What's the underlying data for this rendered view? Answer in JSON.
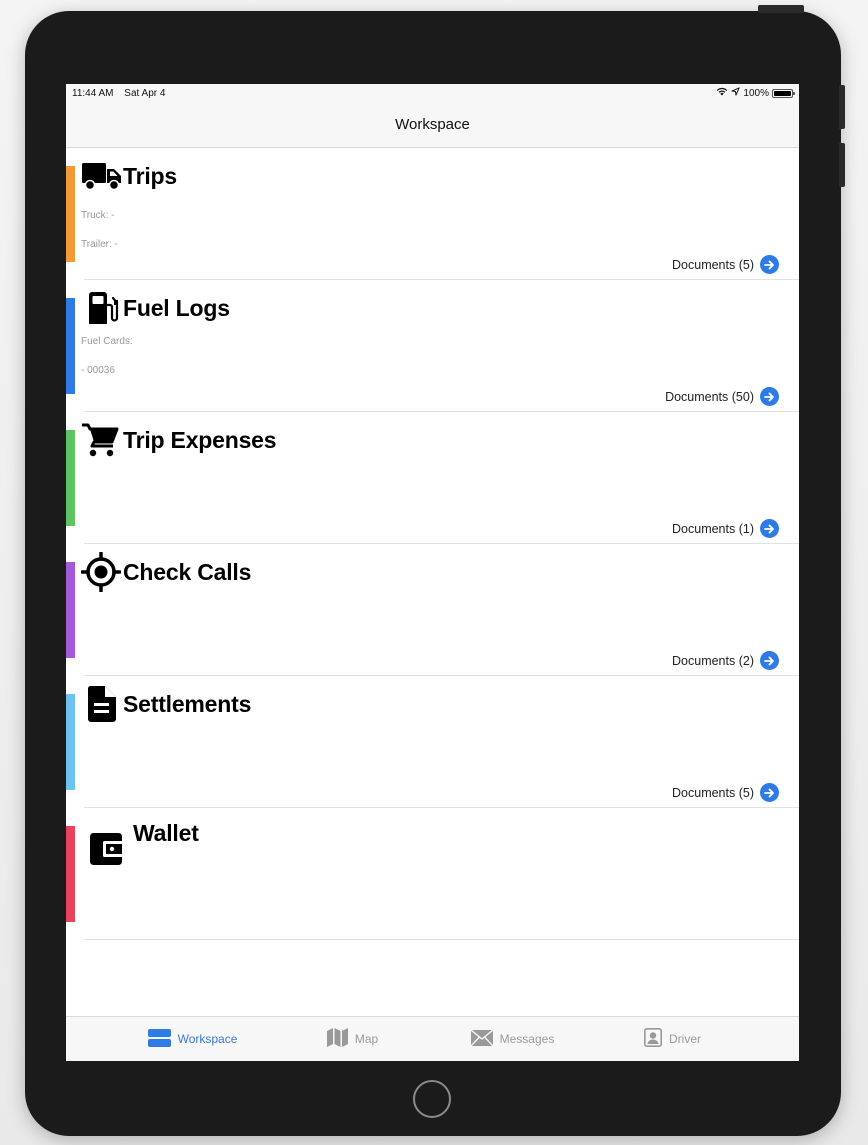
{
  "status_bar": {
    "time": "11:44 AM",
    "date": "Sat Apr 4",
    "battery": "100%",
    "icons": [
      "wifi-icon",
      "location-icon",
      "battery-icon"
    ]
  },
  "nav": {
    "title": "Workspace"
  },
  "sections": [
    {
      "id": "trips",
      "title": "Trips",
      "icon": "truck-icon",
      "accent": "#f29a38",
      "lines": [
        "Truck: -",
        "Trailer: -"
      ],
      "documents_label": "Documents (5)"
    },
    {
      "id": "fuel-logs",
      "title": "Fuel Logs",
      "icon": "fuel-pump-icon",
      "accent": "#2f7be5",
      "lines": [
        "Fuel Cards:",
        "- 00036"
      ],
      "documents_label": "Documents (50)"
    },
    {
      "id": "trip-expenses",
      "title": "Trip Expenses",
      "icon": "shopping-cart-icon",
      "accent": "#5ec462",
      "lines": [],
      "documents_label": "Documents (1)"
    },
    {
      "id": "check-calls",
      "title": "Check Calls",
      "icon": "crosshair-icon",
      "accent": "#a45bd8",
      "lines": [],
      "documents_label": "Documents (2)"
    },
    {
      "id": "settlements",
      "title": "Settlements",
      "icon": "document-icon",
      "accent": "#6cc3ef",
      "lines": [],
      "documents_label": "Documents (5)"
    },
    {
      "id": "wallet",
      "title": "Wallet",
      "icon": "wallet-icon",
      "accent": "#e8425f",
      "lines": [],
      "documents_label": null
    }
  ],
  "tab_bar": {
    "tabs": [
      {
        "label": "Workspace",
        "icon": "workspace-icon",
        "active": true
      },
      {
        "label": "Map",
        "icon": "map-icon",
        "active": false
      },
      {
        "label": "Messages",
        "icon": "envelope-icon",
        "active": false
      },
      {
        "label": "Driver",
        "icon": "driver-icon",
        "active": false
      }
    ],
    "active_color": "#3a7bd5",
    "inactive_color": "#9a9a9a"
  }
}
